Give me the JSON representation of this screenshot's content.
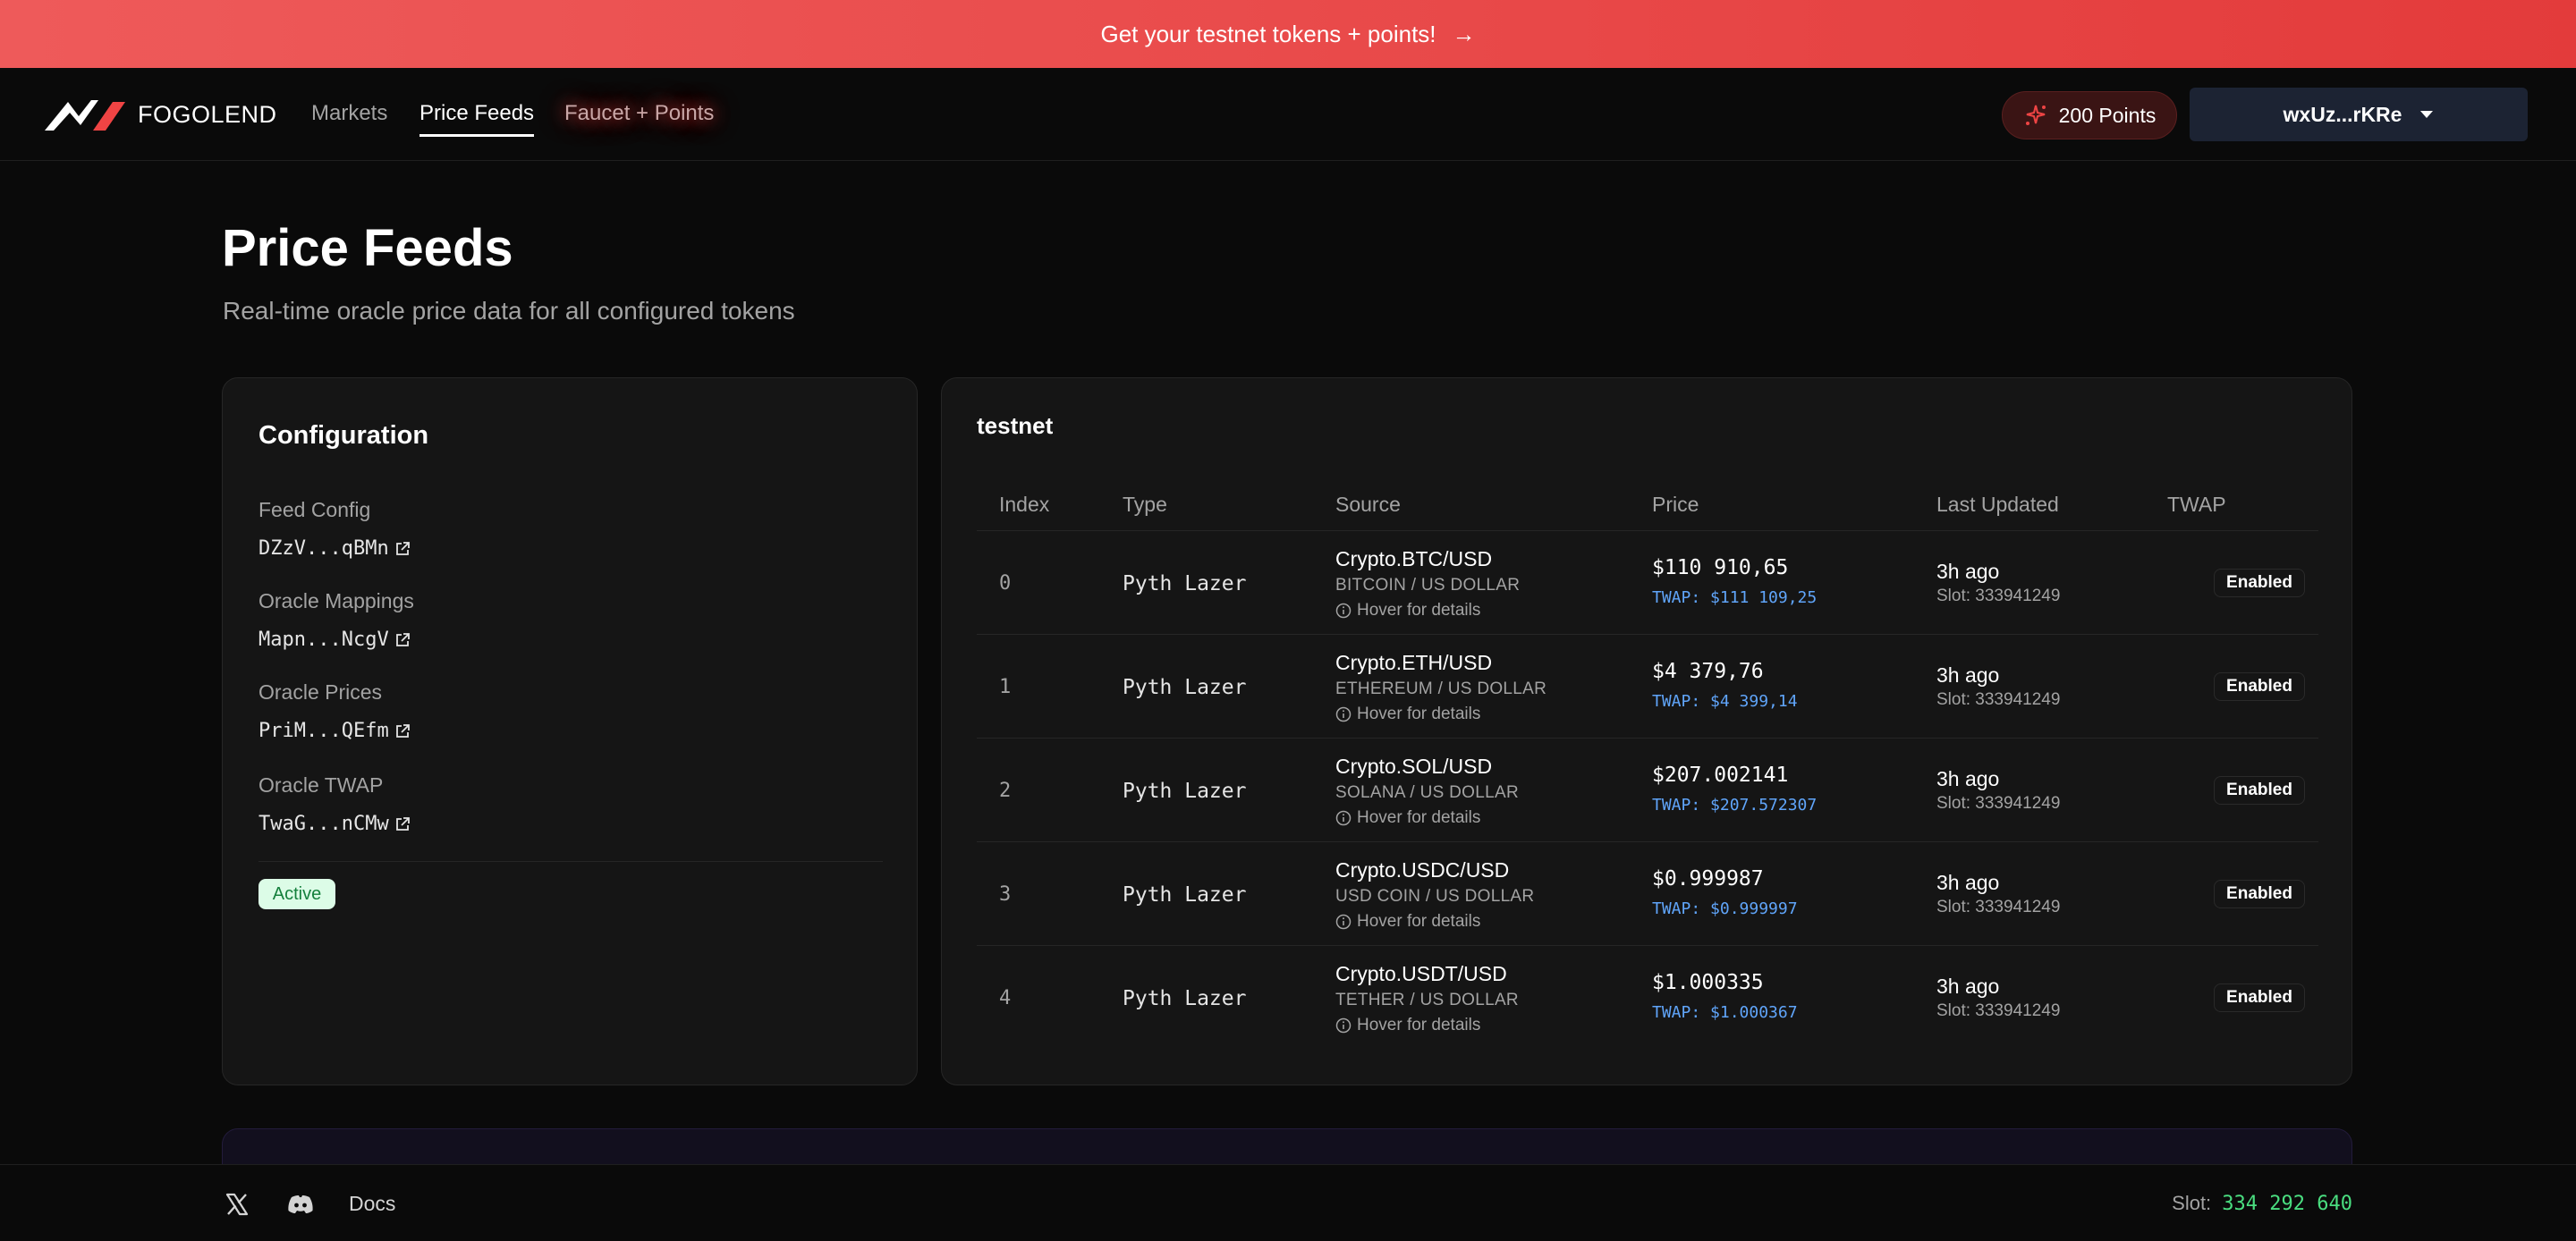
{
  "banner": {
    "text": "Get your testnet tokens + points!",
    "arrow": "→"
  },
  "nav": {
    "brand": "FOGOLEND",
    "links": [
      "Markets",
      "Price Feeds",
      "Faucet + Points"
    ],
    "active": "Price Feeds",
    "points_label": "200 Points",
    "wallet_label": "wxUz...rKRe"
  },
  "header": {
    "title": "Price Feeds",
    "subtitle": "Real-time oracle price data for all configured tokens"
  },
  "config": {
    "title": "Configuration",
    "items": [
      {
        "label": "Feed Config",
        "value": "DZzV...qBMn"
      },
      {
        "label": "Oracle Mappings",
        "value": "Mapn...NcgV"
      },
      {
        "label": "Oracle Prices",
        "value": "PriM...QEfm"
      },
      {
        "label": "Oracle TWAP",
        "value": "TwaG...nCMw"
      }
    ],
    "status": "Active"
  },
  "feeds": {
    "network": "testnet",
    "columns": [
      "Index",
      "Type",
      "Source",
      "Price",
      "Last Updated",
      "TWAP"
    ],
    "rows": [
      {
        "index": "0",
        "type": "Pyth Lazer",
        "source": "Crypto.BTC/USD",
        "source_desc": "BITCOIN / US DOLLAR",
        "hover": "Hover for details",
        "price": "$110 910,65",
        "twap": "TWAP: $111 109,25",
        "updated": "3h ago",
        "slot": "Slot: 333941249",
        "twap_status": "Enabled"
      },
      {
        "index": "1",
        "type": "Pyth Lazer",
        "source": "Crypto.ETH/USD",
        "source_desc": "ETHEREUM / US DOLLAR",
        "hover": "Hover for details",
        "price": "$4 379,76",
        "twap": "TWAP: $4 399,14",
        "updated": "3h ago",
        "slot": "Slot: 333941249",
        "twap_status": "Enabled"
      },
      {
        "index": "2",
        "type": "Pyth Lazer",
        "source": "Crypto.SOL/USD",
        "source_desc": "SOLANA / US DOLLAR",
        "hover": "Hover for details",
        "price": "$207.002141",
        "twap": "TWAP: $207.572307",
        "updated": "3h ago",
        "slot": "Slot: 333941249",
        "twap_status": "Enabled"
      },
      {
        "index": "3",
        "type": "Pyth Lazer",
        "source": "Crypto.USDC/USD",
        "source_desc": "USD COIN / US DOLLAR",
        "hover": "Hover for details",
        "price": "$0.999987",
        "twap": "TWAP: $0.999997",
        "updated": "3h ago",
        "slot": "Slot: 333941249",
        "twap_status": "Enabled"
      },
      {
        "index": "4",
        "type": "Pyth Lazer",
        "source": "Crypto.USDT/USD",
        "source_desc": "TETHER / US DOLLAR",
        "hover": "Hover for details",
        "price": "$1.000335",
        "twap": "TWAP: $1.000367",
        "updated": "3h ago",
        "slot": "Slot: 333941249",
        "twap_status": "Enabled"
      }
    ]
  },
  "footer": {
    "docs": "Docs",
    "slot_label": "Slot:",
    "slot_value": "334 292 640",
    "icons": [
      "x-icon",
      "discord-icon"
    ]
  },
  "colors": {
    "banner": "#e84848",
    "accent_twap": "#60a5fa",
    "active_badge_bg": "#dcfce7",
    "slot_green": "#4ade80"
  }
}
